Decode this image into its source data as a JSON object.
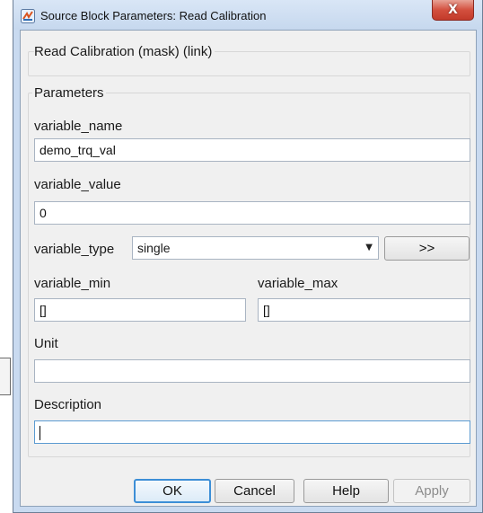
{
  "window": {
    "title": "Source Block Parameters: Read Calibration"
  },
  "icons": {
    "app": "simulink-app-icon",
    "close": "close-icon"
  },
  "close_glyph": "X",
  "block": {
    "description": "Read Calibration (mask) (link)"
  },
  "parameters": {
    "group_label": "Parameters",
    "variable_name": {
      "label": "variable_name",
      "value": "demo_trq_val"
    },
    "variable_value": {
      "label": "variable_value",
      "value": "0"
    },
    "variable_type": {
      "label": "variable_type",
      "value": "single",
      "more_button": ">>"
    },
    "variable_min": {
      "label": "variable_min",
      "value": "[]"
    },
    "variable_max": {
      "label": "variable_max",
      "value": "[]"
    },
    "unit": {
      "label": "Unit",
      "value": ""
    },
    "description": {
      "label": "Description",
      "value": ""
    }
  },
  "buttons": {
    "ok": "OK",
    "cancel": "Cancel",
    "help": "Help",
    "apply": "Apply"
  },
  "colors": {
    "focus_border": "#5c9bd1",
    "default_button": "#3c8ed6",
    "close_button": "#d3503f"
  }
}
